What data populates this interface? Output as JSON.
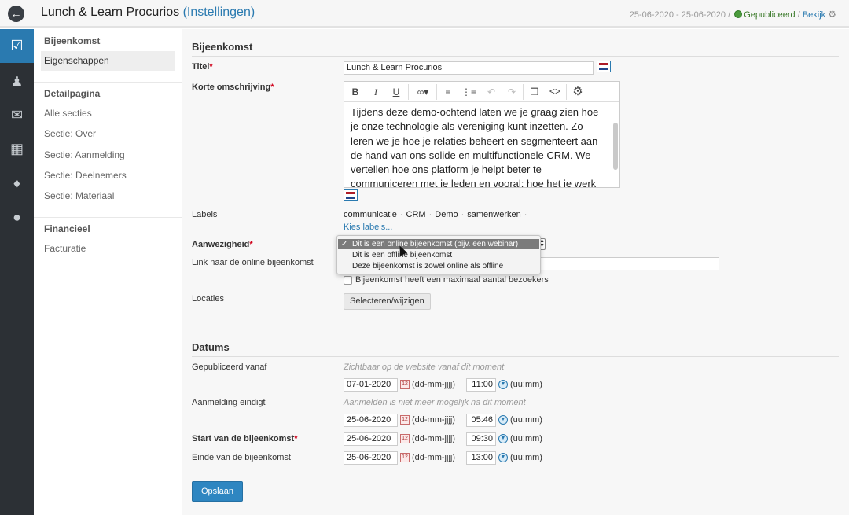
{
  "header": {
    "title": "Lunch & Learn Procurios",
    "subtitle": "(Instellingen)",
    "date_range": "25-06-2020 - 25-06-2020",
    "separator": "/",
    "status": "Gepubliceerd",
    "view_link": "Bekijk",
    "back_icon": "arrow-left-icon",
    "settings_icon": "gear-icon"
  },
  "leftnav": {
    "icons": [
      "checkbox-icon",
      "people-icon",
      "chat-icon",
      "table-icon",
      "ticket-icon",
      "piggy-bank-icon"
    ],
    "active_index": 0
  },
  "submenu": {
    "sections": [
      {
        "title": "Bijeenkomst",
        "items": [
          "Eigenschappen"
        ]
      },
      {
        "title": "Detailpagina",
        "items": [
          "Alle secties",
          "Sectie: Over",
          "Sectie: Aanmelding",
          "Sectie: Deelnemers",
          "Sectie: Materiaal"
        ]
      },
      {
        "title": "Financieel",
        "items": [
          "Facturatie"
        ]
      }
    ],
    "active_item": "Eigenschappen"
  },
  "form": {
    "section_title": "Bijeenkomst",
    "title_label": "Titel",
    "title_value": "Lunch & Learn Procurios",
    "description_label": "Korte omschrijving",
    "description_text": "Tijdens deze demo-ochtend laten we je graag zien hoe je onze technologie als vereniging kunt inzetten. Zo leren we je hoe je relaties beheert en segmenteert aan de hand van ons solide en multifunctionele CRM. We vertellen hoe ons platform je helpt beter te communiceren met je leden en vooral: hoe het je werk uit handen neemt. Want wat kan",
    "editor_toolbar": [
      "bold-icon",
      "italic-icon",
      "underline-icon",
      "link-icon",
      "bullet-list-icon",
      "numbered-list-icon",
      "undo-icon",
      "redo-icon",
      "paste-icon",
      "code-icon",
      "gear-icon"
    ],
    "labels_label": "Labels",
    "labels": [
      "communicatie",
      "CRM",
      "Demo",
      "samenwerken"
    ],
    "choose_labels": "Kies labels...",
    "attendance_label": "Aanwezigheid",
    "attendance_options": [
      "Dit is een online bijeenkomst (bijv. een webinar)",
      "Dit is een offline bijeenkomst",
      "Deze bijeenkomst is zowel online als offline"
    ],
    "attendance_selected": 0,
    "online_link_label": "Link naar de online bijeenkomst",
    "online_link_value": "",
    "max_visitors_label": "Bijeenkomst heeft een maximaal aantal bezoekers",
    "max_visitors_checked": false,
    "locations_label": "Locaties",
    "locations_button": "Selecteren/wijzigen"
  },
  "dates": {
    "section_title": "Datums",
    "date_format": "(dd-mm-jjjj)",
    "time_format": "(uu:mm)",
    "rows": [
      {
        "label": "Gepubliceerd vanaf",
        "hint": "Zichtbaar op de website vanaf dit moment",
        "date": "07-01-2020",
        "time": "11:00",
        "required": false
      },
      {
        "label": "Aanmelding eindigt",
        "hint": "Aanmelden is niet meer mogelijk na dit moment",
        "date": "25-06-2020",
        "time": "05:46",
        "required": false
      },
      {
        "label": "Start van de bijeenkomst",
        "hint": "",
        "date": "25-06-2020",
        "time": "09:30",
        "required": true
      },
      {
        "label": "Einde van de bijeenkomst",
        "hint": "",
        "date": "25-06-2020",
        "time": "13:00",
        "required": false
      }
    ]
  },
  "actions": {
    "save": "Opslaan"
  },
  "colors": {
    "accent": "#2a7ab0",
    "nav_bg": "#2c3035",
    "required": "#d0021b",
    "published": "#4a9a3c"
  }
}
